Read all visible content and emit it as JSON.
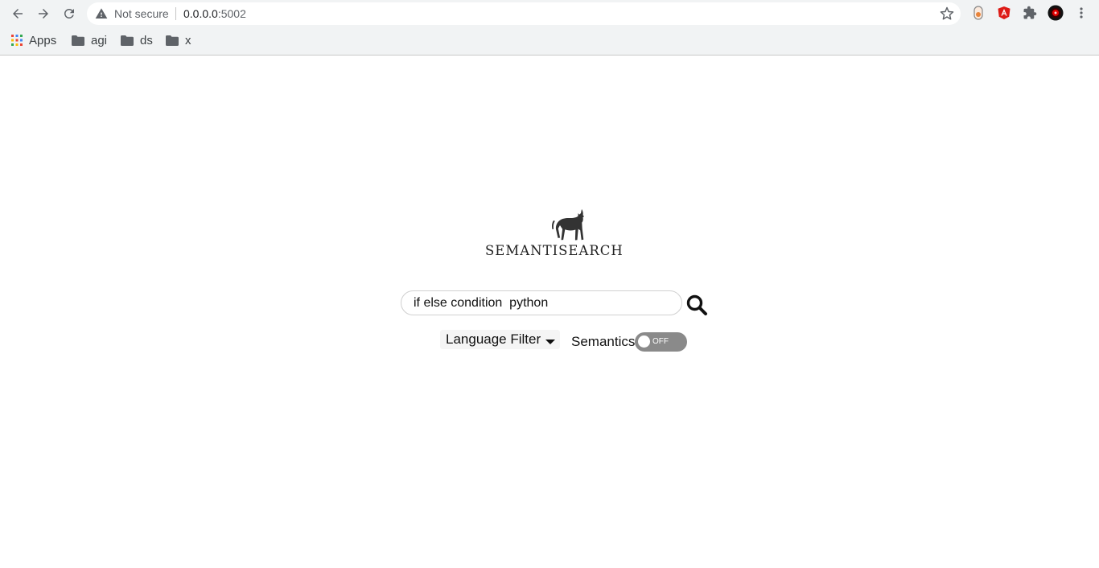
{
  "browser": {
    "security_label": "Not secure",
    "url_host": "0.0.0.0",
    "url_port": ":5002",
    "bookmarks": [
      {
        "label": "Apps",
        "icon": "apps-grid-icon"
      },
      {
        "label": "agi",
        "icon": "folder-icon"
      },
      {
        "label": "ds",
        "icon": "folder-icon"
      },
      {
        "label": "x",
        "icon": "folder-icon"
      }
    ]
  },
  "page": {
    "logo_text": "SEMANTISEARCH",
    "search": {
      "value": "if else condition  python",
      "placeholder": ""
    },
    "language_filter_label": "Language Filter",
    "semantics_label": "Semantics",
    "toggle_state": "OFF"
  },
  "colors": {
    "toggle_off": "#8a8a8a",
    "chrome_bg": "#f1f3f4"
  }
}
